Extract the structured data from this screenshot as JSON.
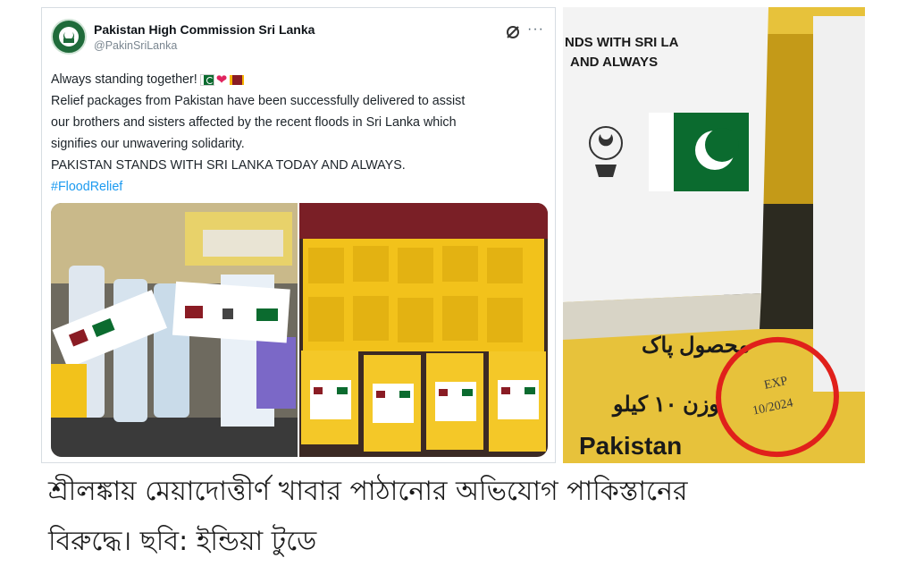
{
  "tweet": {
    "display_name": "Pakistan High Commission Sri Lanka",
    "handle": "@PakinSriLanka",
    "line1": "Always standing together!",
    "line2": "Relief packages from Pakistan have been successfully delivered to assist",
    "line3": "our brothers and sisters affected by the recent floods in Sri Lanka which",
    "line4": "signifies our unwavering solidarity.",
    "line5": "PAKISTAN STANDS WITH SRI LANKA TODAY AND ALWAYS.",
    "hashtag": "#FloodRelief",
    "more_glyph": "···",
    "icons": [
      "pakistan-flag-icon",
      "red-heart-icon",
      "sri-lanka-flag-icon",
      "grok-icon",
      "more-icon",
      "emblem-icon"
    ]
  },
  "zoom_photo": {
    "label_line1": "NDS WITH SRI LA",
    "label_line2": "AND ALWAYS",
    "urdu_line1": "محصول پاک",
    "urdu_line2": "وزن ۱۰ کیلو",
    "brand": "Pakistan",
    "stamp_line1": "EXP",
    "stamp_line2": "10/2024",
    "highlight_color": "#e0201b"
  },
  "caption": {
    "line1": "শ্রীলঙ্কায় মেয়াদোত্তীর্ণ খাবার পাঠানোর অভিযোগ পাকিস্তানের",
    "line2": "বিরুদ্ধে। ছবি: ইন্ডিয়া টুডে"
  },
  "colors": {
    "hashtag": "#1d9bf0",
    "bag_yellow": "#f2c21b",
    "pakistan_green": "#0b6b2f"
  }
}
